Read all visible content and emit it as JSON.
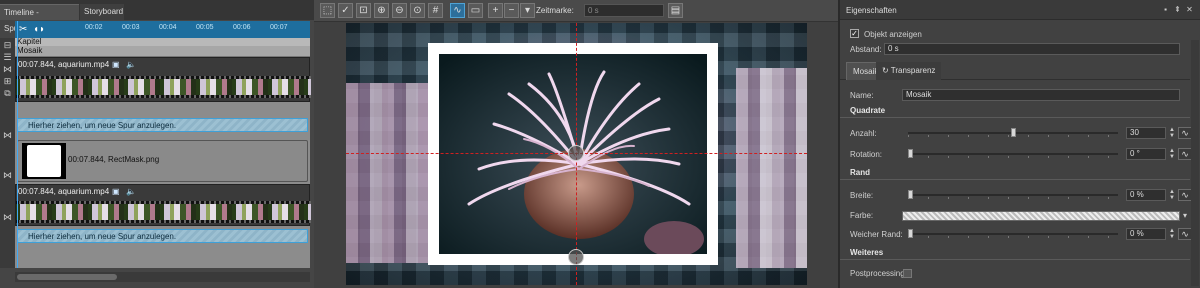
{
  "timeline": {
    "tabs": [
      "Timeline - Spuransicht",
      "Storyboard"
    ],
    "ruler_ticks": [
      "00:02",
      "00:03",
      "00:04",
      "00:05",
      "00:06",
      "00:07"
    ],
    "tracks": {
      "kapitel": "Kapitel",
      "mosaik": "Mosaik",
      "clip1": "00:07.844,  aquarium.mp4",
      "drop1": "Hierher ziehen, um neue Spur anzulegen.",
      "mask_clip": "00:07.844, RectMask.png",
      "clip2": "00:07.844,  aquarium.mp4",
      "drop2": "Hierher ziehen, um neue Spur anzulegen."
    }
  },
  "preview": {
    "toolbar": {
      "timecode_label": "Zeitmarke:",
      "timecode_value": "0 s"
    }
  },
  "properties": {
    "title": "Eigenschaften",
    "show_object": {
      "label": "Objekt anzeigen",
      "checked": true
    },
    "abstand": {
      "label": "Abstand:",
      "value": "0 s"
    },
    "tabs": [
      "Mosaik",
      "Transparenz"
    ],
    "name": {
      "label": "Name:",
      "value": "Mosaik"
    },
    "sections": {
      "quadrate": "Quadrate",
      "rand": "Rand",
      "weiteres": "Weiteres"
    },
    "anzahl": {
      "label": "Anzahl:",
      "value": "30",
      "level": 0.5
    },
    "rotation": {
      "label": "Rotation:",
      "value": "0 °",
      "level": 0.0
    },
    "breite": {
      "label": "Breite:",
      "value": "0 %",
      "level": 0.0
    },
    "farbe": {
      "label": "Farbe:"
    },
    "weicher_rand": {
      "label": "Weicher Rand:",
      "value": "0 %",
      "level": 0.0
    },
    "postprocessing": {
      "label": "Postprocessing"
    }
  }
}
